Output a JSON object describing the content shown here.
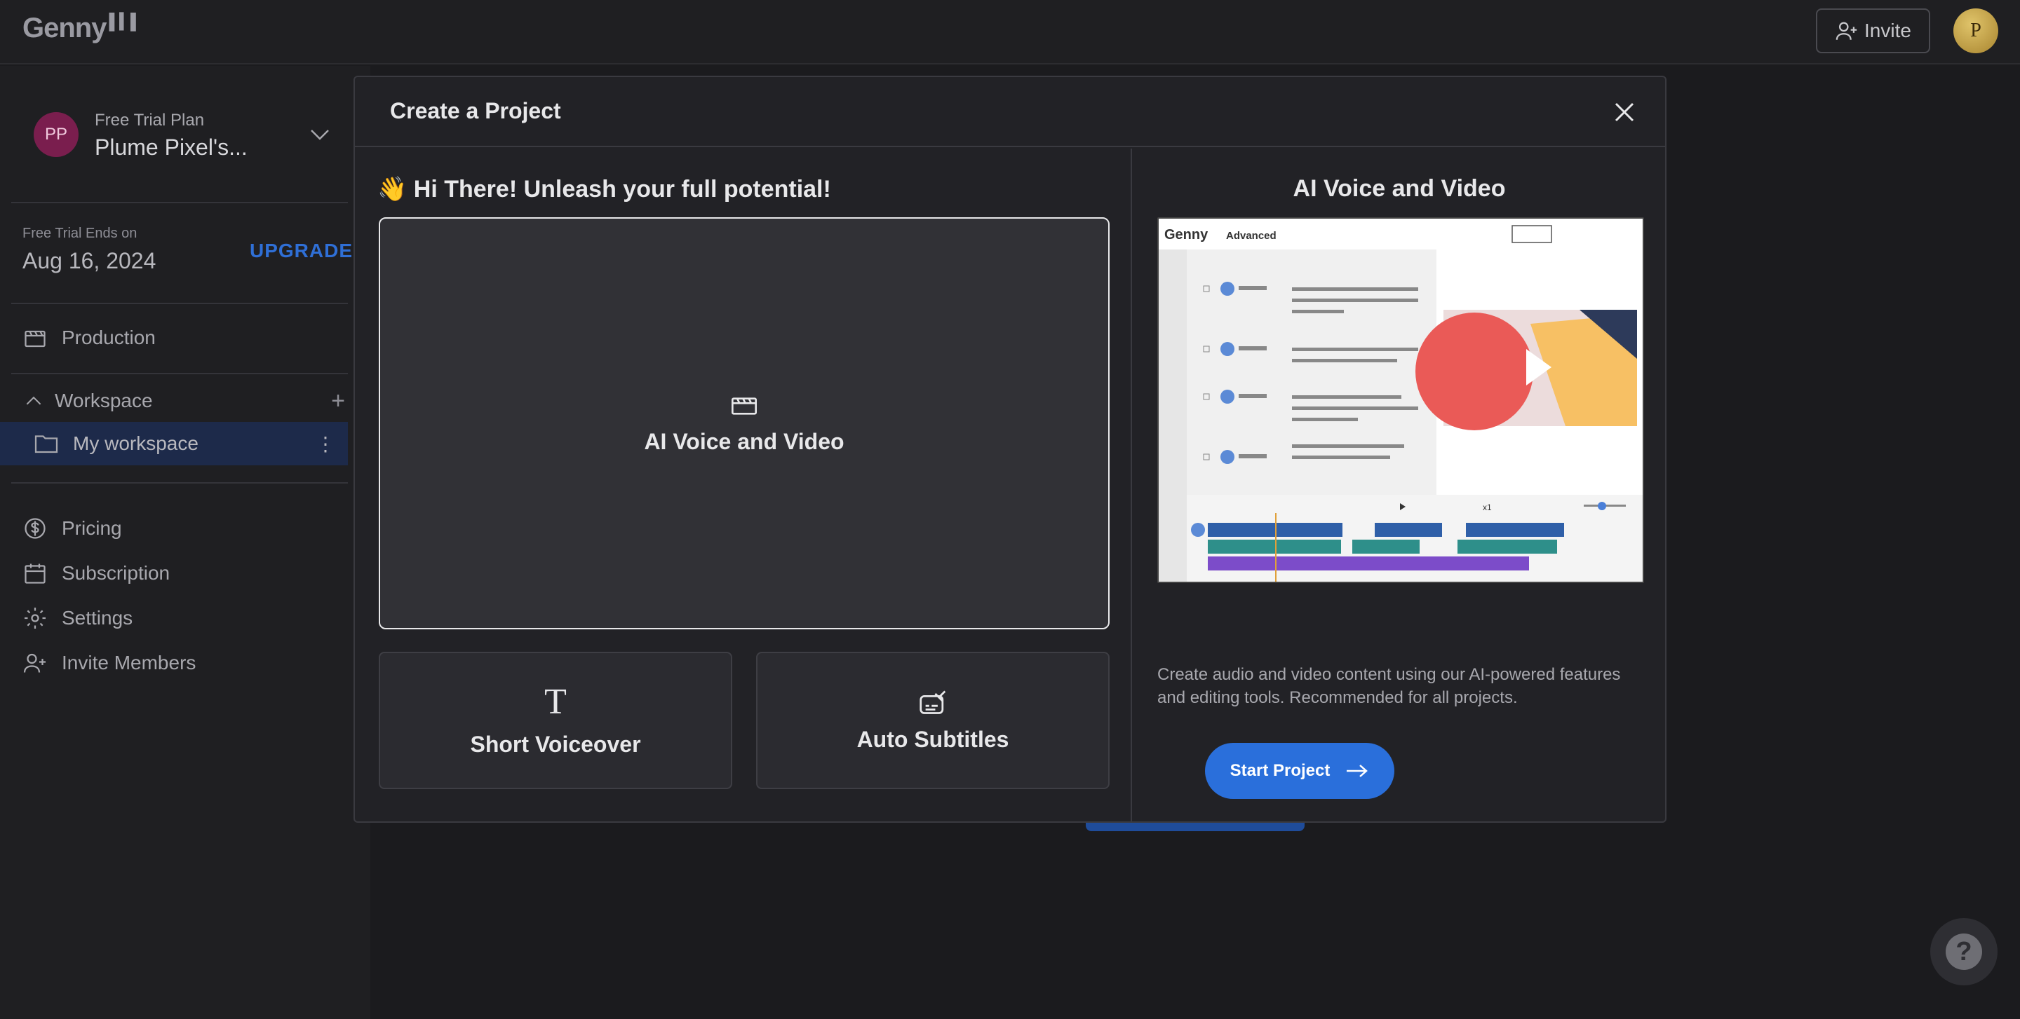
{
  "app": {
    "logo": "Genny"
  },
  "topbar": {
    "invite_label": "Invite",
    "avatar_initial": "P"
  },
  "sidebar": {
    "account": {
      "initials": "PP",
      "plan": "Free Trial Plan",
      "name": "Plume Pixel's..."
    },
    "trial": {
      "label": "Free Trial Ends on",
      "date": "Aug 16, 2024",
      "upgrade": "UPGRADE"
    },
    "production": "Production",
    "workspace": {
      "label": "Workspace",
      "item": "My workspace"
    },
    "bottom": [
      "Pricing",
      "Subscription",
      "Settings",
      "Invite Members"
    ]
  },
  "modal": {
    "title": "Create a Project",
    "greeting": "👋 Hi There! Unleash your full potential!",
    "options": [
      {
        "label": "AI Voice and Video",
        "icon": "clapperboard-icon",
        "selected": true
      },
      {
        "label": "Short Voiceover",
        "icon": "text-t-icon"
      },
      {
        "label": "Auto Subtitles",
        "icon": "subtitles-icon"
      }
    ],
    "preview": {
      "title": "AI Voice and Video",
      "app_logo": "Genny",
      "mode": "Advanced",
      "speed": "x1",
      "description": "Create audio and video content using our AI-powered features and editing tools. Recommended for all projects."
    },
    "start_label": "Start Project"
  },
  "help": {
    "label": "?"
  },
  "colors": {
    "accent": "#2a6fdb",
    "upgrade": "#2f6fd6",
    "selected_row": "#1d2a4a"
  }
}
